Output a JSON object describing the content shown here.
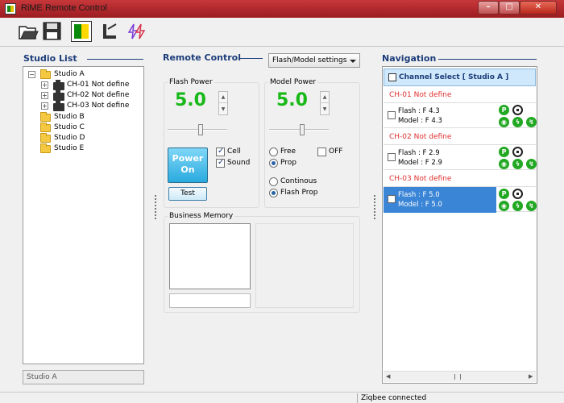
{
  "window": {
    "title": "RiME Remote Control"
  },
  "studio_list": {
    "title": "Studio List",
    "tree": {
      "root": "Studio A",
      "channels": [
        "CH-01 Not define",
        "CH-02 Not define",
        "CH-03 Not define"
      ],
      "others": [
        "Studio B",
        "Studio C",
        "Studio D",
        "Studio E"
      ]
    },
    "status": "Studio A"
  },
  "remote_control": {
    "title": "Remote Control",
    "mode_select": "Flash/Model settings",
    "flash_power": {
      "label": "Flash Power",
      "value": "5.0"
    },
    "model_power": {
      "label": "Model Power",
      "value": "5.0"
    },
    "power_button": {
      "line1": "Power",
      "line2": "On"
    },
    "test_button": "Test",
    "cell_label": "Cell",
    "sound_label": "Sound",
    "free_label": "Free",
    "prop_label": "Prop",
    "off_label": "OFF",
    "continous_label": "Continous",
    "flash_prop_label": "Flash Prop",
    "business_memory_label": "Business Memory"
  },
  "navigation": {
    "title": "Navigation",
    "channel_select": "Channel Select [ Studio A ]",
    "channels": [
      {
        "header": "CH-01  Not define",
        "flash": "Flash : F 4.3",
        "model": "Model : F 4.3",
        "selected": false
      },
      {
        "header": "CH-02  Not define",
        "flash": "Flash : F 2.9",
        "model": "Model : F 2.9",
        "selected": false
      },
      {
        "header": "CH-03  Not define",
        "flash": "Flash : F 5.0",
        "model": "Model : F 5.0",
        "selected": true
      }
    ]
  },
  "statusbar": {
    "text": "Ziqbee connected"
  },
  "colors": {
    "titlebar": "#b02a2e",
    "section_title": "#1c3d7a",
    "power_value": "#18b818",
    "power_button": "#2aaadf",
    "selected_row": "#3b85d6",
    "channel_header": "#e03030"
  }
}
